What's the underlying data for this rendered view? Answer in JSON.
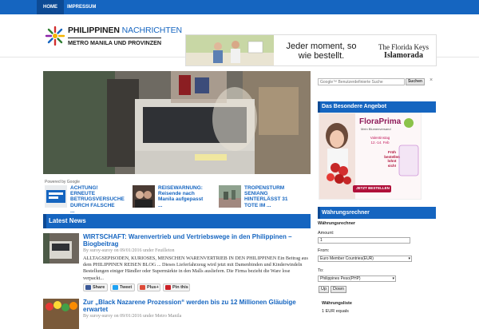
{
  "nav": {
    "items": [
      {
        "label": "HOME"
      },
      {
        "label": "IMPRESSUM"
      }
    ]
  },
  "logo": {
    "name_part1": "PHILIPPINEN",
    "name_part2": "NACHRICHTEN",
    "subtitle": "METRO MANILA UND PROVINZEN"
  },
  "banner": {
    "slogan": "Jeder moment, so wie bestellt.",
    "brand_top": "The Florida Keys",
    "brand_name": "Islamorada"
  },
  "ads": {
    "label": "Powered by Google",
    "items": [
      {
        "title": "ACHTUNG! ERNEUTE BETRUGSVERSUCHE DURCH FALSCHE ..."
      },
      {
        "title": "REISEWARNUNG:",
        "rest": "Reisende nach Manila aufgepasst ..."
      },
      {
        "title": "TROPENSTURM SENIANG hinterlässt 31 Tote im ..."
      }
    ]
  },
  "latest_news": {
    "heading": "Latest News",
    "posts": [
      {
        "title": "WIRTSCHAFT: Warenvertrieb und Vertriebswege in den Philippinen – Biogbeitrag",
        "meta": "By suroy-suroy on 09/01/2016 under Feuilleton",
        "excerpt": "ALLTAGSEPISODEN, KURIOSES, MENSCHEN WARENVERTRIEB IN DEN PHILIPPINEN Ein Beitrag aus dem PHILIPPINEN REISEN BLOG ... Dieses Lieferfahrzeug wird jetzt mit Damenbinden und Kinderwindeln Bestellungen einiger Händler oder Supermärkte in den Malls ausliefern. Die Firma bezieht die Ware lose verpackt...",
        "share": [
          {
            "label": "Share",
            "color": "#3b5998"
          },
          {
            "label": "Tweet",
            "color": "#1da1f2"
          },
          {
            "label": "Plus+",
            "color": "#dd4b39"
          },
          {
            "label": "Pin this",
            "color": "#cb2027"
          }
        ]
      },
      {
        "title": "Zur „Black Nazarene Prozession“ werden bis zu 12 Millionen Gläubige erwartet",
        "meta": "By suroy-suroy on 09/01/2016 under Metro Manila"
      }
    ]
  },
  "search": {
    "placeholder": "Google™ Benutzerdefinierte Suche",
    "button": "Suchen",
    "clear": "×"
  },
  "sidebar": {
    "offer_title": "Das Besondere Angebot",
    "promo": {
      "brand": "FloraPrima",
      "tagline": "Mein Blumenversand",
      "valentine": "Valentinstag 12.-14. Feb",
      "order_text": "Früh bestellen lohnt sich!",
      "cta": "JETZT BESTELLEN"
    },
    "currency_title": "Währungsrechner",
    "currency": {
      "heading": "Währungsrechner",
      "amount_label": "Amount:",
      "amount_value": "1",
      "from_label": "From:",
      "from_value": "Euro Member Countries(EUR)",
      "to_label": "To:",
      "to_value": "Philippines Peso(PHP)",
      "up_button": "Up",
      "down_button": "Down",
      "list_heading": "Währungsliste",
      "list_first": "1 EUR equals"
    }
  },
  "colors": {
    "primary": "#1565c0",
    "primary_dark": "#0d4a94",
    "link": "#1565c0"
  }
}
